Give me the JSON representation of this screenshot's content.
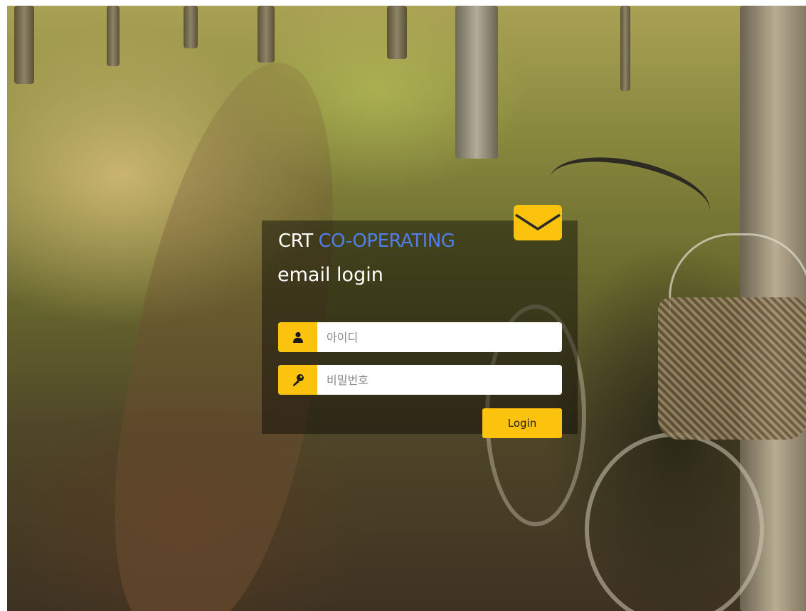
{
  "header": {
    "brand_prefix": "CRT",
    "brand_accent": "CO-OPERATING",
    "subtitle": "email login"
  },
  "form": {
    "username": {
      "value": "",
      "placeholder": "아이디",
      "icon": "user-icon"
    },
    "password": {
      "value": "",
      "placeholder": "비밀번호",
      "icon": "key-icon"
    },
    "login_label": "Login"
  },
  "icons": {
    "mail": "envelope-icon"
  },
  "colors": {
    "accent": "#fcc30e",
    "brand_accent": "#4f7fe9",
    "panel_overlay": "rgba(0,0,0,0.42)"
  }
}
